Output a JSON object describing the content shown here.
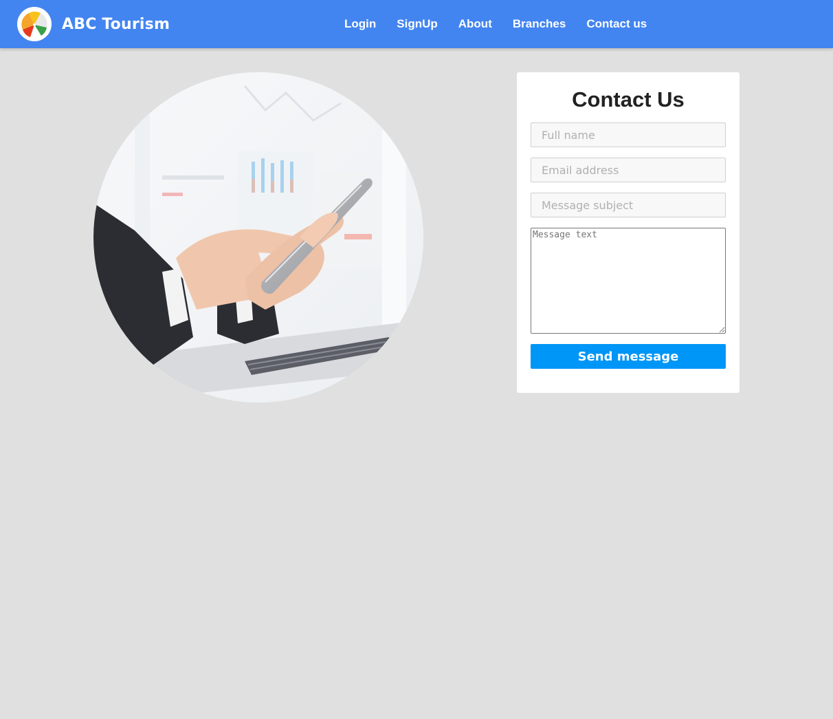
{
  "navbar": {
    "brand": "ABC Tourism",
    "background_color": "#4285f0",
    "links": [
      {
        "label": "Login"
      },
      {
        "label": "SignUp"
      },
      {
        "label": "About"
      },
      {
        "label": "Branches"
      },
      {
        "label": "Contact us"
      }
    ]
  },
  "hero": {
    "icon": "hands-using-smartphone-photo"
  },
  "contact_form": {
    "title": "Contact Us",
    "fields": {
      "full_name": {
        "placeholder": "Full name",
        "value": ""
      },
      "email": {
        "placeholder": "Email address",
        "value": ""
      },
      "subject": {
        "placeholder": "Message subject",
        "value": ""
      },
      "message": {
        "placeholder": "Message text",
        "value": ""
      }
    },
    "submit_label": "Send message",
    "submit_color": "#0096f7"
  }
}
